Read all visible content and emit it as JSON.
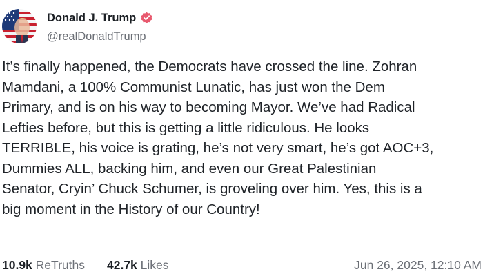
{
  "author": {
    "display_name": "Donald J. Trump",
    "handle": "@realDonaldTrump",
    "verified_icon": "verified-badge-icon",
    "avatar_icon": "profile-photo",
    "verified_color": "#e8596e"
  },
  "post": {
    "lines": [
      "It’s finally happened, the Democrats have crossed the line. Zohran",
      "Mamdani, a 100% Communist Lunatic, has just won the Dem",
      "Primary, and is on his way to becoming Mayor. We’ve had Radical",
      "Lefties before, but this is getting a little ridiculous. He looks",
      "TERRIBLE, his voice is grating, he’s not very smart, he’s got AOC+3,",
      "Dummies ALL, backing him, and even our Great Palestinian",
      "Senator, Cryin’ Chuck Schumer, is groveling over him. Yes, this is a",
      "big moment in the History of our Country!"
    ]
  },
  "stats": {
    "retruths_count": "10.9k",
    "retruths_label": "ReTruths",
    "likes_count": "42.7k",
    "likes_label": "Likes",
    "timestamp": "Jun 26, 2025, 12:10 AM"
  }
}
